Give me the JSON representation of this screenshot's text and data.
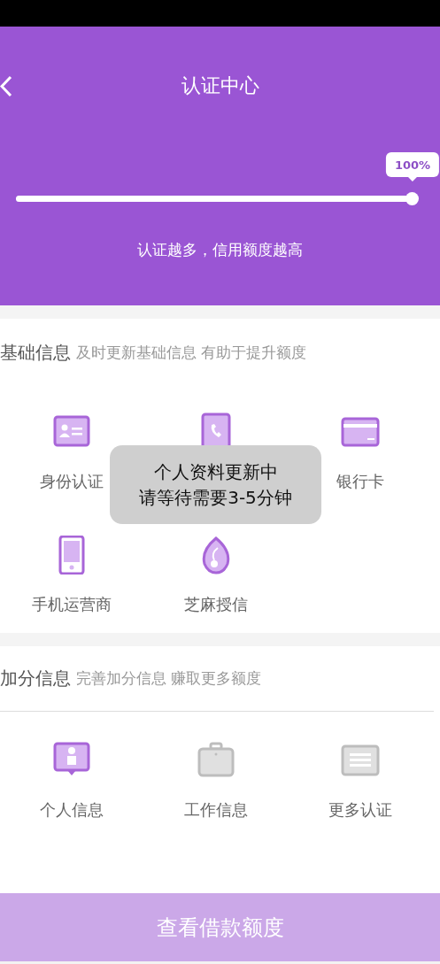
{
  "header": {
    "title": "认证中心",
    "progress": {
      "level": 1,
      "badge": "100%"
    },
    "subtitle": "认证越多，信用额度越高"
  },
  "sections": [
    {
      "title": "基础信息",
      "hint": "及时更新基础信息 有助于提升额度",
      "divider": false,
      "items": [
        {
          "kind": "id-card",
          "label": "身份认证",
          "done": true
        },
        {
          "kind": "contacts",
          "done": true
        },
        {
          "kind": "bank-card",
          "label": "银行卡",
          "done": true
        },
        {
          "kind": "phone",
          "label": "手机运营商",
          "done": true
        },
        {
          "kind": "drop",
          "label": "芝麻授信",
          "done": true
        }
      ]
    },
    {
      "title": "加分信息",
      "hint": "完善加分信息 赚取更多额度",
      "divider": true,
      "items": [
        {
          "kind": "profile",
          "label": "个人信息",
          "done": true
        },
        {
          "kind": "briefcase",
          "label": "工作信息",
          "done": false
        },
        {
          "kind": "list",
          "label": "更多认证",
          "done": false
        }
      ]
    }
  ],
  "toast": {
    "lines": [
      "个人资料更新中",
      "请等待需要3-5分钟"
    ]
  },
  "button": {
    "label": "查看借款额度"
  }
}
